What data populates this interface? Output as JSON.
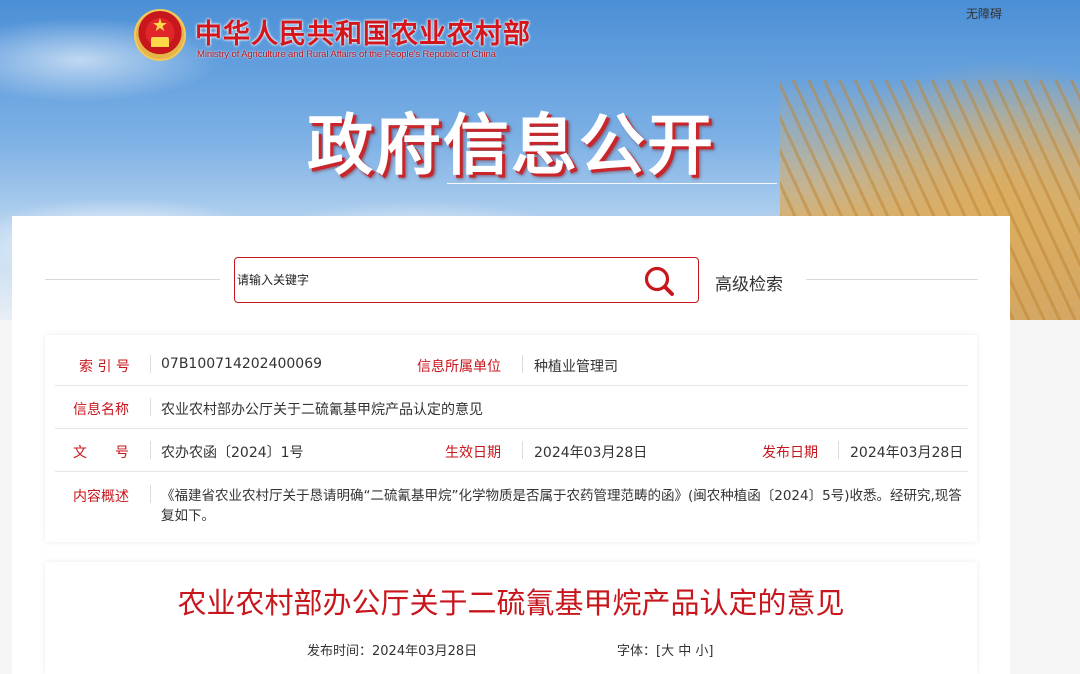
{
  "header": {
    "site_title": "中华人民共和国农业农村部",
    "site_subtitle": "Ministry of Agriculture and Rural Affairs of the People's Republic of China",
    "accessibility": "无障碍",
    "page_title": "政府信息公开"
  },
  "search": {
    "placeholder": "请输入关键字",
    "advanced": "高级检索"
  },
  "info": {
    "index_label": "索 引 号",
    "index_value": "07B100714202400069",
    "unit_label": "信息所属单位",
    "unit_value": "种植业管理司",
    "name_label": "信息名称",
    "name_value": "农业农村部办公厅关于二硫氰基甲烷产品认定的意见",
    "doc_label": "文　　号",
    "doc_value": "农办农函〔2024〕1号",
    "effective_label": "生效日期",
    "effective_value": "2024年03月28日",
    "publish_label": "发布日期",
    "publish_value": "2024年03月28日",
    "summary_label": "内容概述",
    "summary_value": "《福建省农业农村厅关于恳请明确“二硫氰基甲烷”化学物质是否属于农药管理范畴的函》(闽农种植函〔2024〕5号)收悉。经研究,现答复如下。"
  },
  "article": {
    "title": "农业农村部办公厅关于二硫氰基甲烷产品认定的意见",
    "publish_time": "发布时间：2024年03月28日",
    "font_label": "字体：[",
    "font_large": "大",
    "font_medium": "中",
    "font_small": "小",
    "font_close": "]"
  },
  "colors": {
    "accent": "#c8161d",
    "text": "#333333"
  }
}
